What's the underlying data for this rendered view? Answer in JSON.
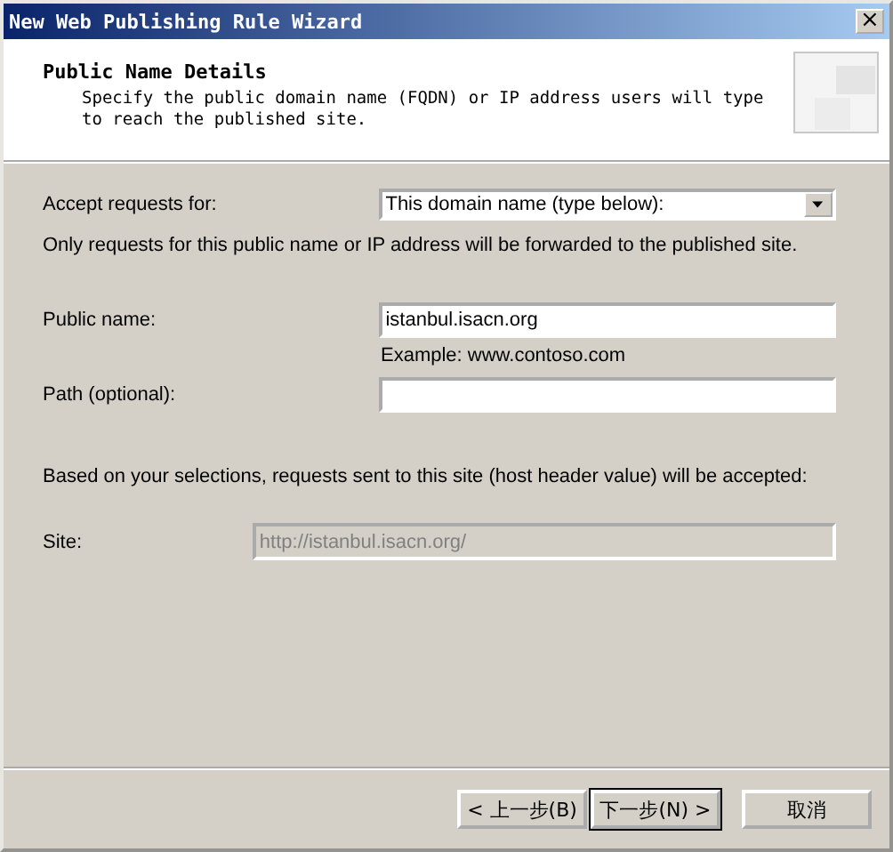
{
  "window": {
    "title": "New Web Publishing Rule Wizard",
    "close": "×"
  },
  "header": {
    "title": "Public Name Details",
    "description": "Specify the public domain name (FQDN) or IP address users will type to reach the published site."
  },
  "accept": {
    "label": "Accept requests for:",
    "value": "This domain name (type below):"
  },
  "accept_note": "Only requests for this public name or IP address will be forwarded to the published site.",
  "public_name": {
    "label": "Public name:",
    "value": "istanbul.isacn.org",
    "hint": "Example: www.contoso.com"
  },
  "path": {
    "label": "Path (optional):"
  },
  "summary": "Based on your selections, requests sent to this site (host header value) will be accepted:",
  "site": {
    "label": "Site:",
    "value": "http://istanbul.isacn.org/",
    "disabled": true
  },
  "buttons": [
    {
      "label": "< 上一步(B)",
      "default": false
    },
    {
      "label": "下一步(N) >",
      "default": true
    },
    {
      "label": "取消",
      "default": false
    }
  ]
}
